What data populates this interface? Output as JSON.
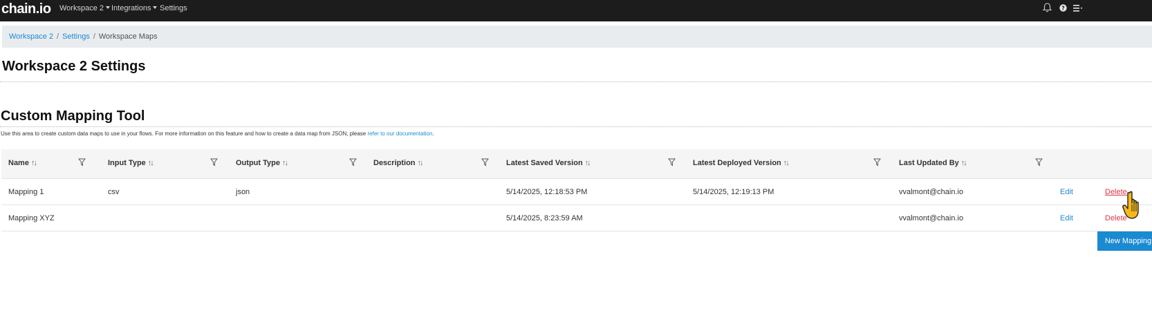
{
  "navbar": {
    "logo": "chain.io",
    "items": [
      {
        "label": "Workspace 2",
        "dropdown": true
      },
      {
        "label": "Integrations",
        "dropdown": true
      },
      {
        "label": "Settings",
        "dropdown": false
      }
    ],
    "icons": [
      "bell-icon",
      "help-icon",
      "menu-icon"
    ]
  },
  "breadcrumb": {
    "items": [
      {
        "label": "Workspace 2",
        "link": true
      },
      {
        "label": "Settings",
        "link": true
      },
      {
        "label": "Workspace Maps",
        "link": false
      }
    ],
    "separator": "/"
  },
  "page": {
    "title": "Workspace 2 Settings",
    "section_title": "Custom Mapping Tool",
    "help_text": "Use this area to create custom data maps to use in your flows. For more information on this feature and how to create a data map from JSON, please ",
    "help_link": "refer to our documentation",
    "help_suffix": "."
  },
  "table": {
    "columns": [
      {
        "label": "Name",
        "sortable": true,
        "filterable": true
      },
      {
        "label": "Input Type",
        "sortable": true,
        "filterable": true
      },
      {
        "label": "Output Type",
        "sortable": true,
        "filterable": true
      },
      {
        "label": "Description",
        "sortable": true,
        "filterable": true
      },
      {
        "label": "Latest Saved Version",
        "sortable": true,
        "filterable": true
      },
      {
        "label": "Latest Deployed Version",
        "sortable": true,
        "filterable": true
      },
      {
        "label": "Last Updated By",
        "sortable": true,
        "filterable": true
      }
    ],
    "rows": [
      {
        "name": "Mapping 1",
        "input_type": "csv",
        "output_type": "json",
        "description": "",
        "latest_saved": "5/14/2025, 12:18:53 PM",
        "latest_deployed": "5/14/2025, 12:19:13 PM",
        "updated_by": "vvalmont@chain.io",
        "edit": "Edit",
        "delete": "Delete"
      },
      {
        "name": "Mapping XYZ",
        "input_type": "",
        "output_type": "",
        "description": "",
        "latest_saved": "5/14/2025, 8:23:59 AM",
        "latest_deployed": "",
        "updated_by": "vvalmont@chain.io",
        "edit": "Edit",
        "delete": "Delete"
      }
    ]
  },
  "new_button_label": "New Mapping",
  "colors": {
    "navbar_bg": "#1c1c1c",
    "link": "#1a8ad1",
    "danger": "#dc3545",
    "primary_button": "#1a8ad1",
    "breadcrumb_bg": "#e9ecef"
  }
}
